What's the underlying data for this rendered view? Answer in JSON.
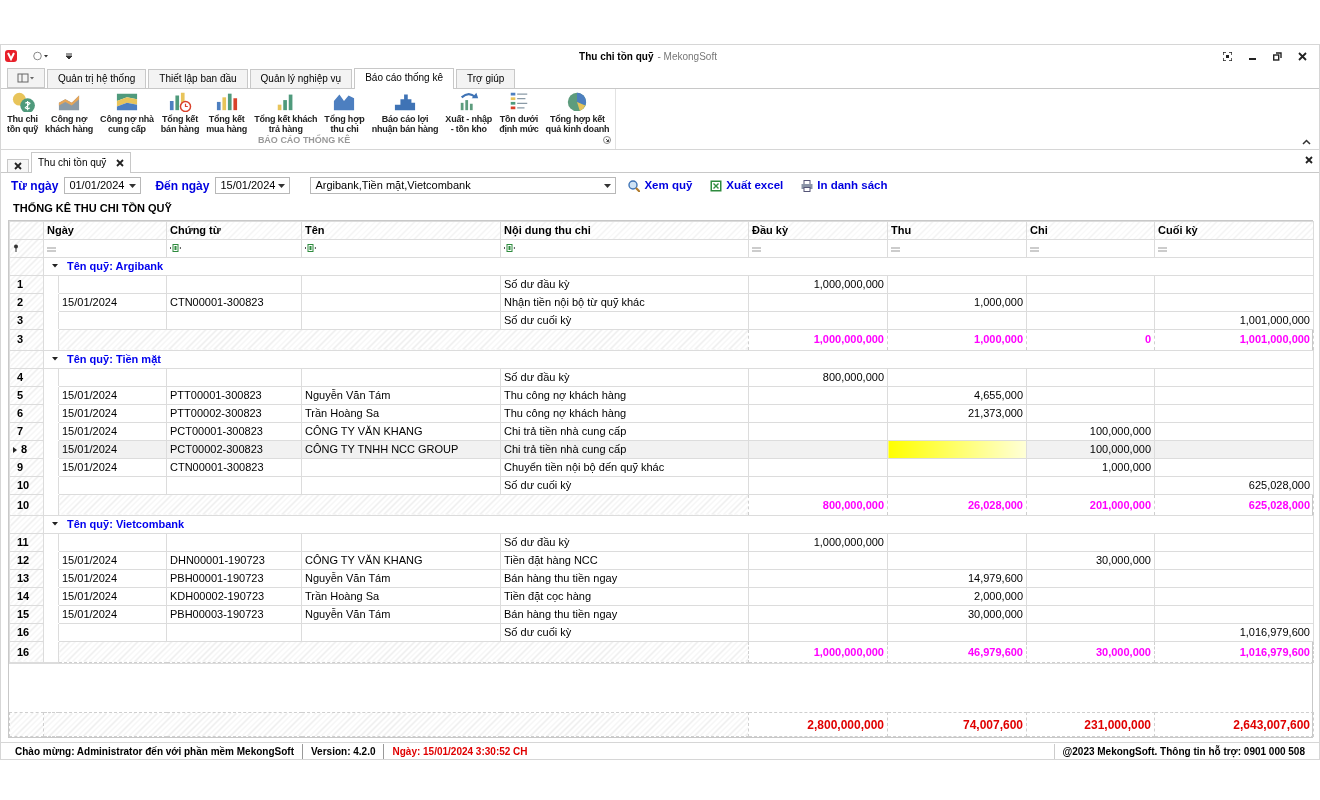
{
  "window": {
    "title": "Thu chi tồn quỹ",
    "app_name": "- MekongSoft"
  },
  "ribbon_tabs": [
    {
      "label": "Quản trị hệ thống",
      "selected": false
    },
    {
      "label": "Thiết lập ban đầu",
      "selected": false
    },
    {
      "label": "Quản lý nghiệp vụ",
      "selected": false
    },
    {
      "label": "Báo cáo thống kê",
      "selected": true
    },
    {
      "label": "Trợ giúp",
      "selected": false
    }
  ],
  "ribbon": {
    "group_label": "BÁO CÁO THỐNG KÊ",
    "buttons": [
      {
        "label": "Thu chi\ntồn quỹ"
      },
      {
        "label": "Công nợ\nkhách hàng"
      },
      {
        "label": "Công nợ nhà\ncung cấp"
      },
      {
        "label": "Tổng kết\nbán hàng"
      },
      {
        "label": "Tổng kết\nmua hàng"
      },
      {
        "label": "Tổng kết khách\ntrả hàng"
      },
      {
        "label": "Tổng hợp\nthu chi"
      },
      {
        "label": "Báo cáo lợi\nnhuận bán hàng"
      },
      {
        "label": "Xuất - nhập\n- tồn kho"
      },
      {
        "label": "Tồn dưới\nđịnh mức"
      },
      {
        "label": "Tổng hợp kết\nquả kinh doanh"
      }
    ]
  },
  "document_tabs": [
    {
      "label": "Thu chi tồn quỹ",
      "selected": true
    }
  ],
  "filters": {
    "from_label": "Từ ngày",
    "from_value": "01/01/2024",
    "to_label": "Đến ngày",
    "to_value": "15/01/2024",
    "funds_value": "Argibank,Tiền mặt,Vietcombank"
  },
  "actions": [
    {
      "label": "Xem quỹ",
      "kind": "search"
    },
    {
      "label": "Xuất excel",
      "kind": "excel"
    },
    {
      "label": "In danh sách",
      "kind": "print"
    }
  ],
  "report_title": "THỐNG KÊ THU CHI TỒN QUỸ",
  "table": {
    "columns": [
      {
        "label": "Ngày",
        "focused": false
      },
      {
        "label": "Chứng từ",
        "focused": false
      },
      {
        "label": "Tên",
        "focused": false
      },
      {
        "label": "Nội dung thu chi",
        "focused": false
      },
      {
        "label": "Đầu kỳ",
        "focused": false
      },
      {
        "label": "Thu",
        "focused": true
      },
      {
        "label": "Chi",
        "focused": false
      },
      {
        "label": "Cuối kỳ",
        "focused": false
      }
    ],
    "groups": [
      {
        "label": "Tên quỹ: Argibank",
        "expanded": true,
        "rows": [
          {
            "no": "1",
            "content": "Số dư đầu kỳ",
            "opening": "1,000,000,000",
            "selected": false
          },
          {
            "no": "2",
            "date": "15/01/2024",
            "voucher": "CTN00001-300823",
            "content": "Nhận tiền nội bộ từ quỹ khác",
            "receipt": "1,000,000",
            "selected": false
          },
          {
            "no": "3",
            "content": "Số dư cuối kỳ",
            "closing": "1,001,000,000",
            "selected": false
          }
        ],
        "summary": {
          "no": "3",
          "opening": "1,000,000,000",
          "receipt": "1,000,000",
          "payment": "0",
          "closing": "1,001,000,000"
        }
      },
      {
        "label": "Tên quỹ: Tiền mặt",
        "expanded": true,
        "rows": [
          {
            "no": "4",
            "content": "Số dư đầu kỳ",
            "opening": "800,000,000",
            "selected": false
          },
          {
            "no": "5",
            "date": "15/01/2024",
            "voucher": "PTT00001-300823",
            "name": "Nguyễn Văn Tám",
            "content": "Thu công nợ khách hàng",
            "receipt": "4,655,000",
            "selected": false
          },
          {
            "no": "6",
            "date": "15/01/2024",
            "voucher": "PTT00002-300823",
            "name": "Trần Hoàng Sa",
            "content": "Thu công nợ khách hàng",
            "receipt": "21,373,000",
            "selected": false
          },
          {
            "no": "7",
            "date": "15/01/2024",
            "voucher": "PCT00001-300823",
            "name": "CÔNG TY VĂN KHANG",
            "content": "Chi trả tiền nhà cung cấp",
            "payment": "100,000,000",
            "selected": false
          },
          {
            "no": "8",
            "date": "15/01/2024",
            "voucher": "PCT00002-300823",
            "name": "CÔNG TY TNHH NCC GROUP",
            "content": "Chi trả tiền nhà cung cấp",
            "payment": "100,000,000",
            "selected": true
          },
          {
            "no": "9",
            "date": "15/01/2024",
            "voucher": "CTN00001-300823",
            "content": "Chuyển tiền nội bộ đến quỹ khác",
            "payment": "1,000,000",
            "selected": false
          },
          {
            "no": "10",
            "content": "Số dư cuối kỳ",
            "closing": "625,028,000",
            "selected": false
          }
        ],
        "summary": {
          "no": "10",
          "opening": "800,000,000",
          "receipt": "26,028,000",
          "payment": "201,000,000",
          "closing": "625,028,000"
        }
      },
      {
        "label": "Tên quỹ: Vietcombank",
        "expanded": true,
        "rows": [
          {
            "no": "11",
            "content": "Số dư đầu kỳ",
            "opening": "1,000,000,000",
            "selected": false
          },
          {
            "no": "12",
            "date": "15/01/2024",
            "voucher": "DHN00001-190723",
            "name": "CÔNG TY VĂN KHANG",
            "content": "Tiền đặt hàng NCC",
            "payment": "30,000,000",
            "selected": false
          },
          {
            "no": "13",
            "date": "15/01/2024",
            "voucher": "PBH00001-190723",
            "name": "Nguyễn Văn Tám",
            "content": "Bán hàng thu tiền ngay",
            "receipt": "14,979,600",
            "selected": false
          },
          {
            "no": "14",
            "date": "15/01/2024",
            "voucher": "KDH00002-190723",
            "name": "Trần Hoàng Sa",
            "content": "Tiền đặt cọc hàng",
            "receipt": "2,000,000",
            "selected": false
          },
          {
            "no": "15",
            "date": "15/01/2024",
            "voucher": "PBH00003-190723",
            "name": "Nguyễn Văn Tám",
            "content": "Bán hàng thu tiền ngay",
            "receipt": "30,000,000",
            "selected": false
          },
          {
            "no": "16",
            "content": "Số dư cuối kỳ",
            "closing": "1,016,979,600",
            "selected": false
          }
        ],
        "summary": {
          "no": "16",
          "opening": "1,000,000,000",
          "receipt": "46,979,600",
          "payment": "30,000,000",
          "closing": "1,016,979,600"
        }
      }
    ],
    "totals": {
      "opening": "2,800,000,000",
      "receipt": "74,007,600",
      "payment": "231,000,000",
      "closing": "2,643,007,600"
    }
  },
  "status_bar": {
    "left": [
      {
        "text": "Chào mừng: Administrator đến với phần mềm MekongSoft",
        "kind": "normal"
      },
      {
        "text": "Version: 4.2.0",
        "kind": "normal"
      },
      {
        "text": "Ngày: 15/01/2024 3:30:52 CH",
        "kind": "alert"
      }
    ],
    "right": "@2023 MekongSoft. Thông tin hỗ trợ: 0901 000 508"
  }
}
